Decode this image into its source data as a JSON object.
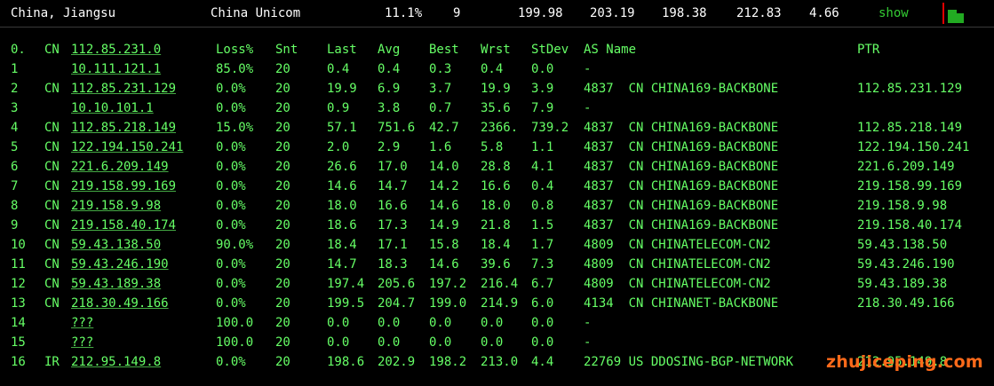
{
  "summary": {
    "location": "China, Jiangsu",
    "isp": "China Unicom",
    "loss": "11.1%",
    "hops": "9",
    "v1": "199.98",
    "v2": "203.19",
    "v3": "198.38",
    "v4": "212.83",
    "v5": "4.66",
    "show_label": "show"
  },
  "colors": {
    "background": "#000000",
    "text": "#66ff66",
    "summary_text": "#ffffff",
    "watermark": "#ff6a1a",
    "graph_border": "#e00000",
    "graph_fill": "#22aa22"
  },
  "table": {
    "header": {
      "no": "0.",
      "cc": "CN",
      "host": "112.85.231.0",
      "loss": "Loss%",
      "snt": "Snt",
      "last": "Last",
      "avg": "Avg",
      "best": "Best",
      "wrst": "Wrst",
      "stdev": "StDev",
      "as": "AS Name",
      "ptr": "PTR"
    },
    "rows": [
      {
        "no": "1",
        "cc": "",
        "host": "10.111.121.1",
        "loss": "85.0%",
        "snt": "20",
        "last": "0.4",
        "avg": "0.4",
        "best": "0.3",
        "wrst": "0.4",
        "stdev": "0.0",
        "as": "-",
        "ptr": ""
      },
      {
        "no": "2",
        "cc": "CN",
        "host": "112.85.231.129",
        "loss": "0.0%",
        "snt": "20",
        "last": "19.9",
        "avg": "6.9",
        "best": "3.7",
        "wrst": "19.9",
        "stdev": "3.9",
        "as": "4837  CN CHINA169-BACKBONE",
        "ptr": "112.85.231.129"
      },
      {
        "no": "3",
        "cc": "",
        "host": "10.10.101.1",
        "loss": "0.0%",
        "snt": "20",
        "last": "0.9",
        "avg": "3.8",
        "best": "0.7",
        "wrst": "35.6",
        "stdev": "7.9",
        "as": "-",
        "ptr": ""
      },
      {
        "no": "4",
        "cc": "CN",
        "host": "112.85.218.149",
        "loss": "15.0%",
        "snt": "20",
        "last": "57.1",
        "avg": "751.6",
        "best": "42.7",
        "wrst": "2366.",
        "stdev": "739.2",
        "as": "4837  CN CHINA169-BACKBONE",
        "ptr": "112.85.218.149"
      },
      {
        "no": "5",
        "cc": "CN",
        "host": "122.194.150.241",
        "loss": "0.0%",
        "snt": "20",
        "last": "2.0",
        "avg": "2.9",
        "best": "1.6",
        "wrst": "5.8",
        "stdev": "1.1",
        "as": "4837  CN CHINA169-BACKBONE",
        "ptr": "122.194.150.241"
      },
      {
        "no": "6",
        "cc": "CN",
        "host": "221.6.209.149",
        "loss": "0.0%",
        "snt": "20",
        "last": "26.6",
        "avg": "17.0",
        "best": "14.0",
        "wrst": "28.8",
        "stdev": "4.1",
        "as": "4837  CN CHINA169-BACKBONE",
        "ptr": "221.6.209.149"
      },
      {
        "no": "7",
        "cc": "CN",
        "host": "219.158.99.169",
        "loss": "0.0%",
        "snt": "20",
        "last": "14.6",
        "avg": "14.7",
        "best": "14.2",
        "wrst": "16.6",
        "stdev": "0.4",
        "as": "4837  CN CHINA169-BACKBONE",
        "ptr": "219.158.99.169"
      },
      {
        "no": "8",
        "cc": "CN",
        "host": "219.158.9.98",
        "loss": "0.0%",
        "snt": "20",
        "last": "18.0",
        "avg": "16.6",
        "best": "14.6",
        "wrst": "18.0",
        "stdev": "0.8",
        "as": "4837  CN CHINA169-BACKBONE",
        "ptr": "219.158.9.98"
      },
      {
        "no": "9",
        "cc": "CN",
        "host": "219.158.40.174",
        "loss": "0.0%",
        "snt": "20",
        "last": "18.6",
        "avg": "17.3",
        "best": "14.9",
        "wrst": "21.8",
        "stdev": "1.5",
        "as": "4837  CN CHINA169-BACKBONE",
        "ptr": "219.158.40.174"
      },
      {
        "no": "10",
        "cc": "CN",
        "host": "59.43.138.50",
        "loss": "90.0%",
        "snt": "20",
        "last": "18.4",
        "avg": "17.1",
        "best": "15.8",
        "wrst": "18.4",
        "stdev": "1.7",
        "as": "4809  CN CHINATELECOM-CN2",
        "ptr": "59.43.138.50"
      },
      {
        "no": "11",
        "cc": "CN",
        "host": "59.43.246.190",
        "loss": "0.0%",
        "snt": "20",
        "last": "14.7",
        "avg": "18.3",
        "best": "14.6",
        "wrst": "39.6",
        "stdev": "7.3",
        "as": "4809  CN CHINATELECOM-CN2",
        "ptr": "59.43.246.190"
      },
      {
        "no": "12",
        "cc": "CN",
        "host": "59.43.189.38",
        "loss": "0.0%",
        "snt": "20",
        "last": "197.4",
        "avg": "205.6",
        "best": "197.2",
        "wrst": "216.4",
        "stdev": "6.7",
        "as": "4809  CN CHINATELECOM-CN2",
        "ptr": "59.43.189.38"
      },
      {
        "no": "13",
        "cc": "CN",
        "host": "218.30.49.166",
        "loss": "0.0%",
        "snt": "20",
        "last": "199.5",
        "avg": "204.7",
        "best": "199.0",
        "wrst": "214.9",
        "stdev": "6.0",
        "as": "4134  CN CHINANET-BACKBONE",
        "ptr": "218.30.49.166"
      },
      {
        "no": "14",
        "cc": "",
        "host": "???",
        "loss": "100.0",
        "snt": "20",
        "last": "0.0",
        "avg": "0.0",
        "best": "0.0",
        "wrst": "0.0",
        "stdev": "0.0",
        "as": "-",
        "ptr": ""
      },
      {
        "no": "15",
        "cc": "",
        "host": "???",
        "loss": "100.0",
        "snt": "20",
        "last": "0.0",
        "avg": "0.0",
        "best": "0.0",
        "wrst": "0.0",
        "stdev": "0.0",
        "as": "-",
        "ptr": ""
      },
      {
        "no": "16",
        "cc": "IR",
        "host": "212.95.149.8",
        "loss": "0.0%",
        "snt": "20",
        "last": "198.6",
        "avg": "202.9",
        "best": "198.2",
        "wrst": "213.0",
        "stdev": "4.4",
        "as": "22769 US DDOSING-BGP-NETWORK",
        "ptr": "212.95.149.8"
      }
    ]
  },
  "watermark": "zhujiceping.com"
}
